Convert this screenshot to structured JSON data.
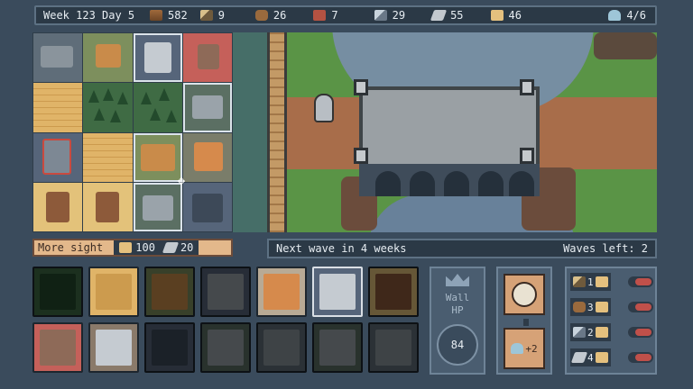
{
  "topbar": {
    "week_day": "Week 123 Day 5",
    "resources": [
      {
        "name": "wood",
        "icon": "wood-log-icon",
        "value": "582"
      },
      {
        "name": "tools",
        "icon": "hammer-icon",
        "value": "9"
      },
      {
        "name": "food",
        "icon": "barrel-icon",
        "value": "26"
      },
      {
        "name": "bricks",
        "icon": "brick-icon",
        "value": "7"
      },
      {
        "name": "iron",
        "icon": "pickaxe-icon",
        "value": "29"
      },
      {
        "name": "stone",
        "icon": "stone-icon",
        "value": "55"
      },
      {
        "name": "planks",
        "icon": "plank-icon",
        "value": "46"
      },
      {
        "name": "population",
        "icon": "worker-icon",
        "value": "4/6"
      }
    ]
  },
  "info": {
    "selected_action": "More sight",
    "cost_planks": "100",
    "cost_stone": "20",
    "next_wave": "Next wave in 4 weeks",
    "waves_left": "Waves left: 2"
  },
  "wall": {
    "label": "Wall HP",
    "hp": "84"
  },
  "ability": {
    "bonus": "+2"
  },
  "upgrades": [
    {
      "icon": "hammer-icon",
      "level": "1"
    },
    {
      "icon": "barrel-icon",
      "level": "3"
    },
    {
      "icon": "pickaxe-icon",
      "level": "2"
    },
    {
      "icon": "stone-icon",
      "level": "4"
    }
  ],
  "colors": {
    "accent": "#e3b88b",
    "panel": "#4a5d70",
    "background": "#3a4b5c",
    "alert": "#c0504a"
  }
}
